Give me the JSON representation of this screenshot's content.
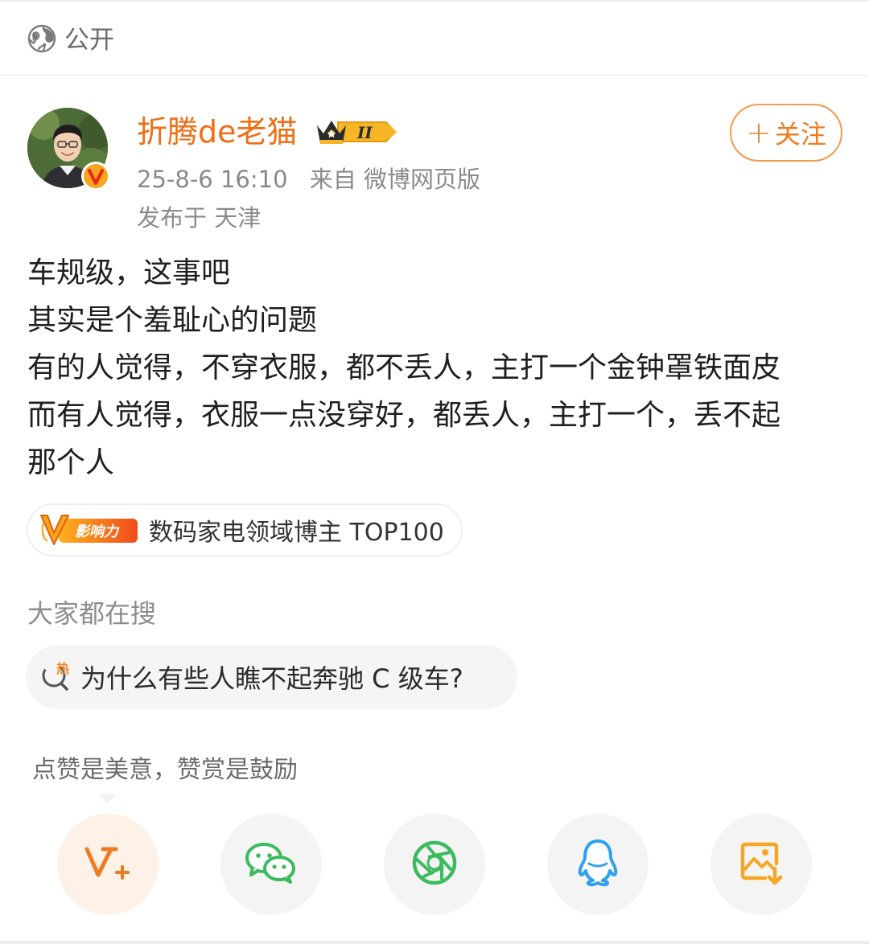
{
  "header": {
    "visibility_label": "公开"
  },
  "author": {
    "name": "折腾de老猫",
    "badge_level": "II",
    "timestamp": "25-8-6 16:10",
    "source": "来自 微博网页版",
    "location": "发布于 天津",
    "follow_label": "关注",
    "accent_color": "#ee6e13"
  },
  "post": {
    "lines": [
      "车规级，这事吧",
      "其实是个羞耻心的问题",
      "有的人觉得，不穿衣服，都不丢人，主打一个金钟罩铁面皮",
      "而有人觉得，衣服一点没穿好，都丢人，主打一个，丢不起",
      "那个人"
    ]
  },
  "influence": {
    "badge_text": "影响力",
    "label": "数码家电领域博主 TOP100"
  },
  "trending": {
    "title": "大家都在搜",
    "hot_mark": "热",
    "query": "为什么有些人瞧不起奔驰 C 级车?"
  },
  "reward_tooltip": "点赞是美意，赞赏是鼓励",
  "share": {
    "buttons": [
      {
        "name": "reward",
        "icon": "reward-v-plus-icon",
        "color": "#ee7b22"
      },
      {
        "name": "wechat",
        "icon": "wechat-icon",
        "color": "#3cba5f"
      },
      {
        "name": "moments",
        "icon": "moments-aperture-icon",
        "color": "#3cba5f"
      },
      {
        "name": "qq",
        "icon": "qq-penguin-icon",
        "color": "#2ea1f0"
      },
      {
        "name": "save-image",
        "icon": "save-image-icon",
        "color": "#f5a623"
      }
    ]
  }
}
